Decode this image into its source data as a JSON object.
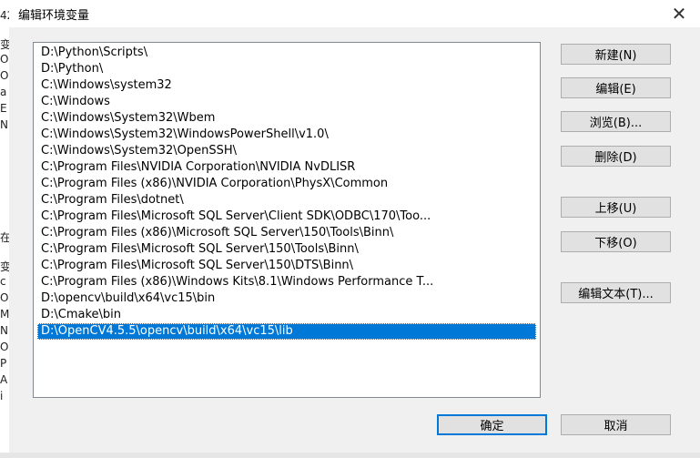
{
  "background_fragments": [
    "42",
    "变",
    "Or",
    "Or",
    "a",
    "E",
    "N",
    "在",
    "变",
    "c",
    "Or",
    "M",
    "N",
    "O",
    "P",
    "A",
    "i"
  ],
  "dialog": {
    "title": "编辑环境变量",
    "close_glyph": "✕"
  },
  "path_list": [
    "D:\\Python\\Scripts\\",
    "D:\\Python\\",
    "C:\\Windows\\system32",
    "C:\\Windows",
    "C:\\Windows\\System32\\Wbem",
    "C:\\Windows\\System32\\WindowsPowerShell\\v1.0\\",
    "C:\\Windows\\System32\\OpenSSH\\",
    "C:\\Program Files\\NVIDIA Corporation\\NVIDIA NvDLISR",
    "C:\\Program Files (x86)\\NVIDIA Corporation\\PhysX\\Common",
    "C:\\Program Files\\dotnet\\",
    "C:\\Program Files\\Microsoft SQL Server\\Client SDK\\ODBC\\170\\Too...",
    "C:\\Program Files (x86)\\Microsoft SQL Server\\150\\Tools\\Binn\\",
    "C:\\Program Files\\Microsoft SQL Server\\150\\Tools\\Binn\\",
    "C:\\Program Files\\Microsoft SQL Server\\150\\DTS\\Binn\\",
    "C:\\Program Files (x86)\\Windows Kits\\8.1\\Windows Performance T...",
    "D:\\opencv\\build\\x64\\vc15\\bin",
    "D:\\Cmake\\bin",
    "D:\\OpenCV4.5.5\\opencv\\build\\x64\\vc15\\lib"
  ],
  "selected_index": 17,
  "buttons": {
    "new": "新建(N)",
    "edit": "编辑(E)",
    "browse": "浏览(B)...",
    "delete": "删除(D)",
    "move_up": "上移(U)",
    "move_down": "下移(O)",
    "edit_text": "编辑文本(T)...",
    "ok": "确定",
    "cancel": "取消"
  },
  "colors": {
    "selection": "#0078d7",
    "default_button_border": "#0078d7"
  }
}
